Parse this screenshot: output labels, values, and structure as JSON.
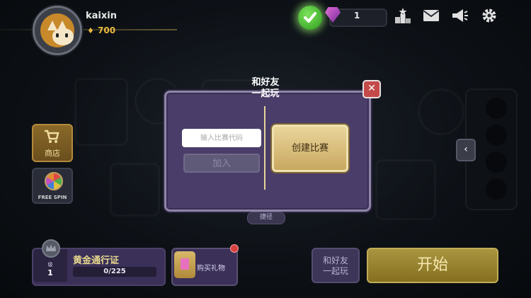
{
  "profile": {
    "username": "kaixin",
    "trophies": "700"
  },
  "currency": {
    "gems": "1"
  },
  "sidebar": {
    "shop_label": "商店",
    "free_spin_label": "FREE SPIN"
  },
  "modal": {
    "title_line1": "和好友",
    "title_line2": "一起玩",
    "code_placeholder": "输入比赛代码",
    "join_label": "加入",
    "create_label": "创建比赛",
    "close_symbol": "✕"
  },
  "quick_label": "捷径",
  "battle_pass": {
    "level_label": "级",
    "level": "1",
    "title": "黄金通行证",
    "progress_text": "0/225",
    "progress_fraction": 0
  },
  "gift": {
    "label": "购买礼物"
  },
  "bottom": {
    "friends_line1": "和好友",
    "friends_line2": "一起玩",
    "start_label": "开始"
  },
  "colors": {
    "accent_gold": "#e9b940",
    "modal_purple": "#4a3d69",
    "start_gold": "#a99540",
    "check_green": "#4fc236"
  }
}
